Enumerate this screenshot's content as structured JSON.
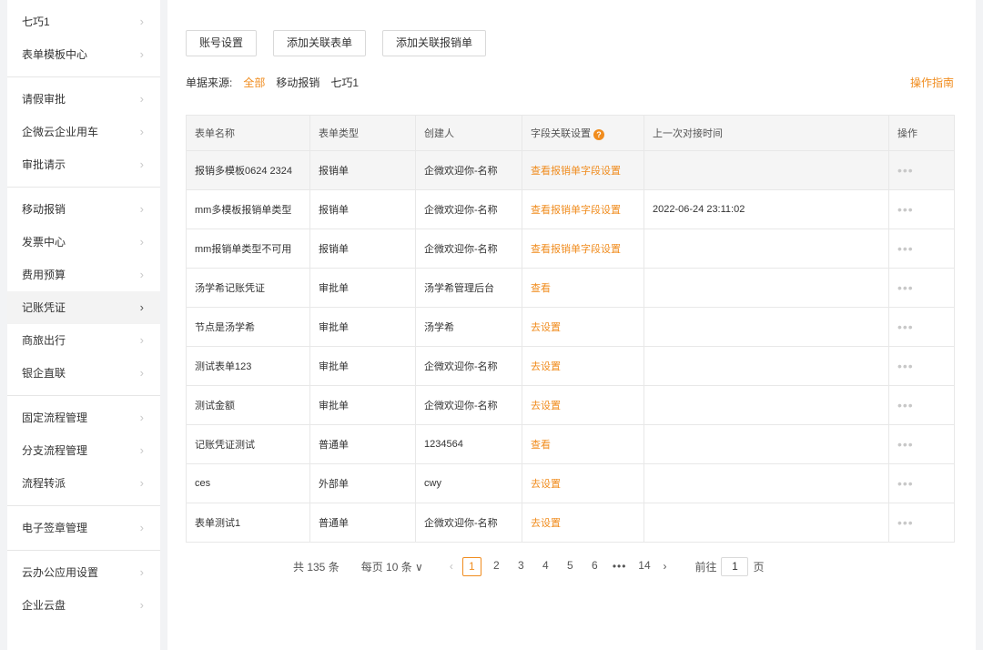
{
  "sidebar": {
    "groups": [
      [
        {
          "label": "七巧1"
        },
        {
          "label": "表单模板中心"
        }
      ],
      [
        {
          "label": "请假审批"
        },
        {
          "label": "企微云企业用车"
        },
        {
          "label": "审批请示"
        }
      ],
      [
        {
          "label": "移动报销"
        },
        {
          "label": "发票中心"
        },
        {
          "label": "费用预算"
        },
        {
          "label": "记账凭证"
        },
        {
          "label": "商旅出行"
        },
        {
          "label": "银企直联"
        }
      ],
      [
        {
          "label": "固定流程管理"
        },
        {
          "label": "分支流程管理"
        },
        {
          "label": "流程转派"
        }
      ],
      [
        {
          "label": "电子签章管理"
        }
      ],
      [
        {
          "label": "云办公应用设置"
        },
        {
          "label": "企业云盘"
        }
      ]
    ],
    "chevron": "›",
    "active_item": "记账凭证"
  },
  "toolbar": {
    "account_settings": "账号设置",
    "add_linked_form": "添加关联表单",
    "add_linked_reimbursement": "添加关联报销单"
  },
  "filter": {
    "label": "单据来源:",
    "options": [
      "全部",
      "移动报销",
      "七巧1"
    ],
    "active": "全部"
  },
  "guide_link": "操作指南",
  "table": {
    "columns": [
      "表单名称",
      "表单类型",
      "创建人",
      "字段关联设置",
      "上一次对接时间",
      "操作"
    ],
    "help_icon": "?",
    "rows": [
      {
        "name": "报销多模板0624 2324",
        "type": "报销单",
        "creator": "企微欢迎你-名称",
        "field": "查看报销单字段设置",
        "time": "",
        "ops": "•••"
      },
      {
        "name": "mm多模板报销单类型",
        "type": "报销单",
        "creator": "企微欢迎你-名称",
        "field": "查看报销单字段设置",
        "time": "2022-06-24 23:11:02",
        "ops": "•••"
      },
      {
        "name": "mm报销单类型不可用",
        "type": "报销单",
        "creator": "企微欢迎你-名称",
        "field": "查看报销单字段设置",
        "time": "",
        "ops": "•••"
      },
      {
        "name": "汤学希记账凭证",
        "type": "审批单",
        "creator": "汤学希管理后台",
        "field": "查看",
        "time": "",
        "ops": "•••"
      },
      {
        "name": "节点是汤学希",
        "type": "审批单",
        "creator": "汤学希",
        "field": "去设置",
        "time": "",
        "ops": "•••"
      },
      {
        "name": "测试表单123",
        "type": "审批单",
        "creator": "企微欢迎你-名称",
        "field": "去设置",
        "time": "",
        "ops": "•••"
      },
      {
        "name": "测试金额",
        "type": "审批单",
        "creator": "企微欢迎你-名称",
        "field": "去设置",
        "time": "",
        "ops": "•••"
      },
      {
        "name": "记账凭证测试",
        "type": "普通单",
        "creator": "1234564",
        "field": "查看",
        "time": "",
        "ops": "•••"
      },
      {
        "name": "ces",
        "type": "外部单",
        "creator": "cwy",
        "field": "去设置",
        "time": "",
        "ops": "•••"
      },
      {
        "name": "表单测试1",
        "type": "普通单",
        "creator": "企微欢迎你-名称",
        "field": "去设置",
        "time": "",
        "ops": "•••"
      }
    ],
    "highlighted_row": 0
  },
  "pagination": {
    "total": "共 135 条",
    "page_size": "每页 10 条 ∨",
    "prev": "‹",
    "next": "›",
    "pages": [
      "1",
      "2",
      "3",
      "4",
      "5",
      "6"
    ],
    "ellipsis": "•••",
    "last_page": "14",
    "current": "1",
    "goto_prefix": "前往",
    "goto_value": "1",
    "goto_suffix": "页"
  },
  "colors": {
    "accent": "#f08c1e",
    "border": "#e8e8e8",
    "header_bg": "#f5f5f5"
  }
}
